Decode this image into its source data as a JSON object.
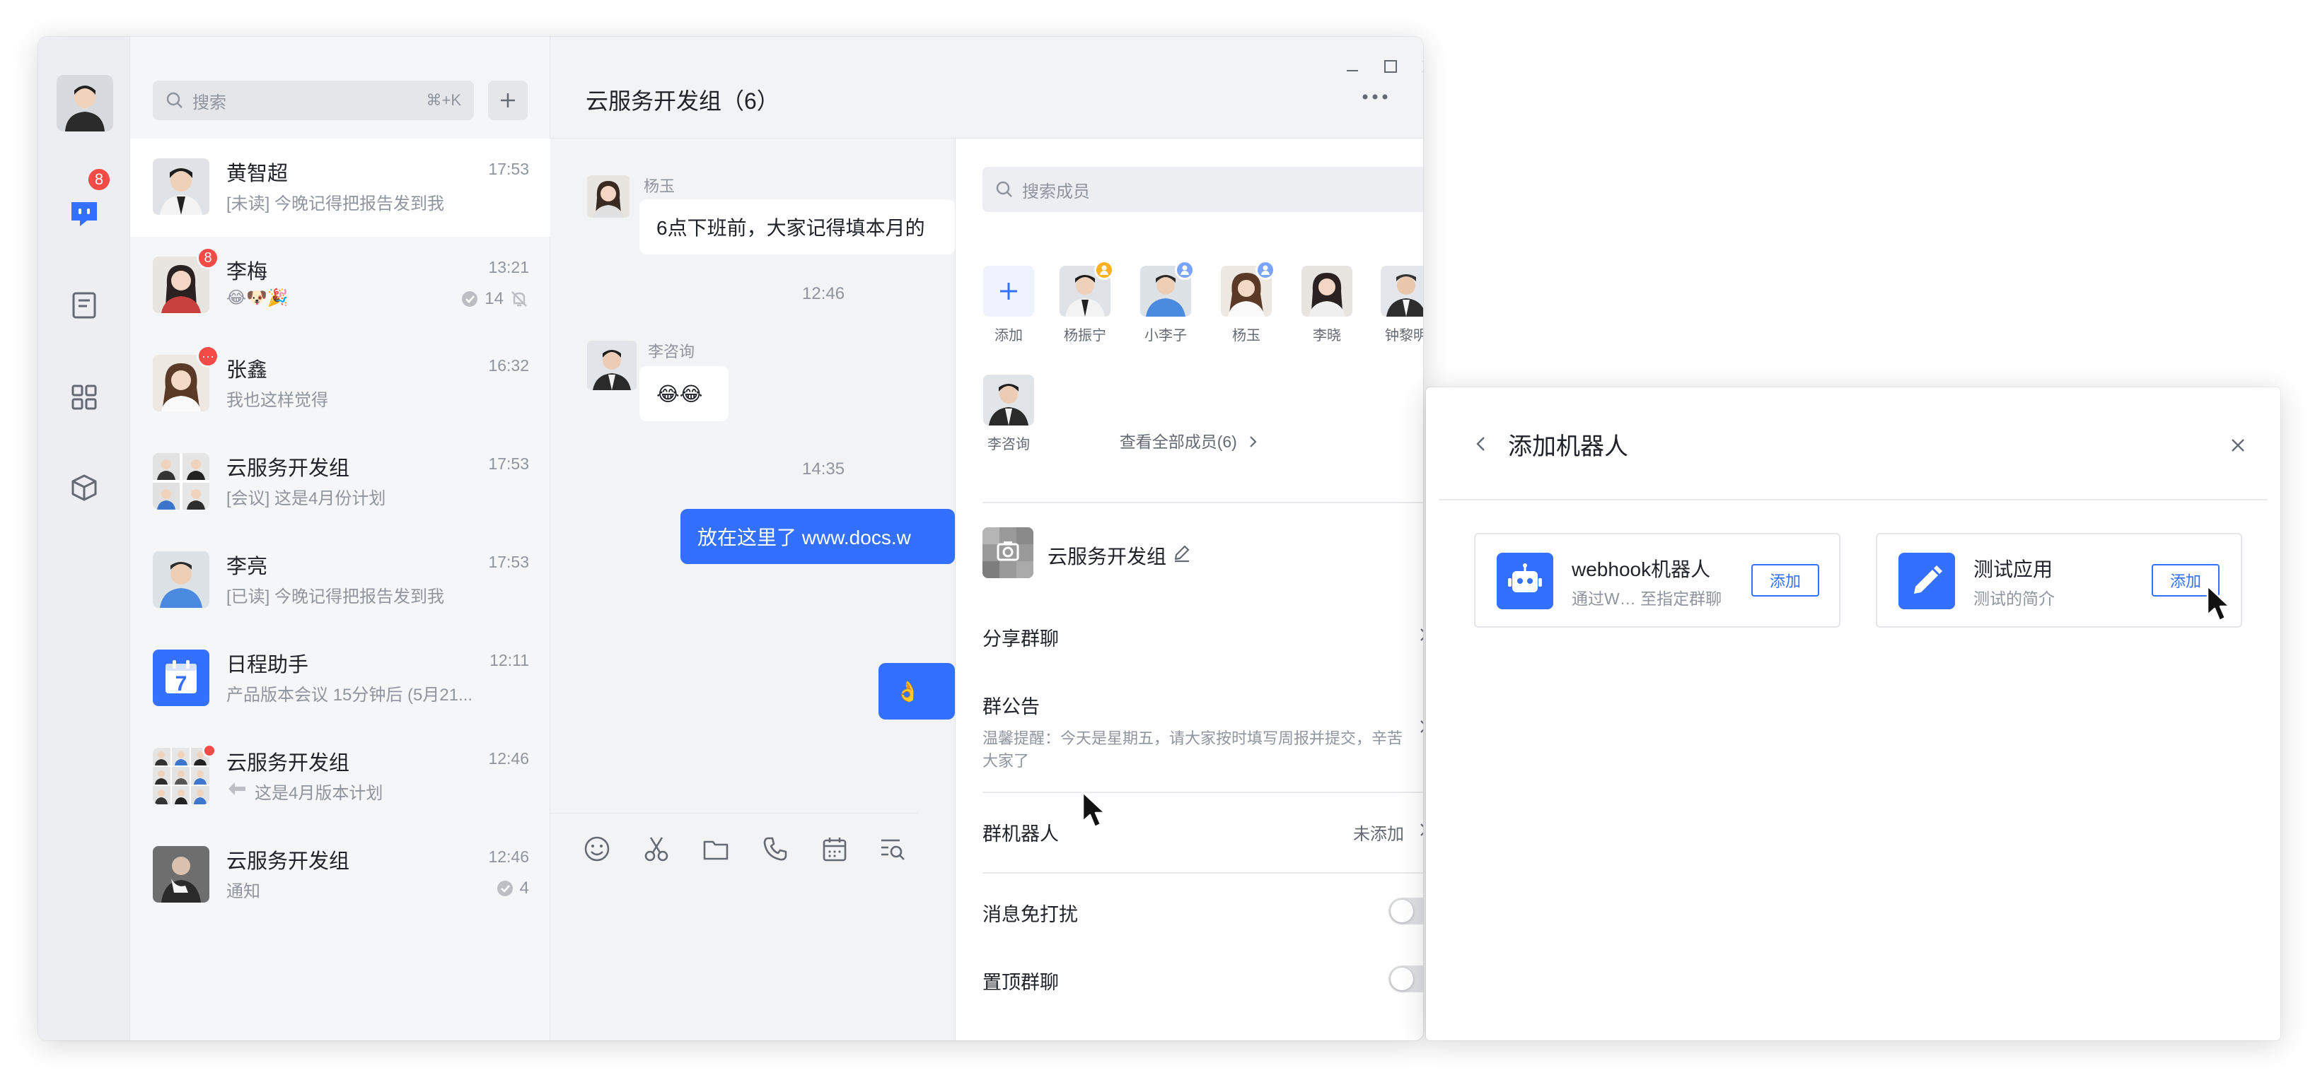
{
  "nav": {
    "messages_badge": "8",
    "icons": [
      "messages-icon",
      "docs-icon",
      "apps-icon",
      "cube-icon"
    ]
  },
  "search": {
    "placeholder": "搜索",
    "shortcut": "⌘+K"
  },
  "conversations": [
    {
      "name": "黄智超",
      "time": "17:53",
      "preview": "[未读] 今晚记得把报告发到我"
    },
    {
      "name": "李梅",
      "time": "13:21",
      "preview": "😂🐶🎉",
      "badge": "8",
      "read_count": "14"
    },
    {
      "name": "张鑫",
      "time": "16:32",
      "preview": "我也这样觉得",
      "badge": "···"
    },
    {
      "name": "云服务开发组",
      "time": "17:53",
      "preview": "[会议] 这是4月份计划"
    },
    {
      "name": "李亮",
      "time": "17:53",
      "preview": "[已读] 今晚记得把报告发到我"
    },
    {
      "name": "日程助手",
      "time": "12:11",
      "preview": "产品版本会议 15分钟后 (5月21...",
      "calendar_day": "7"
    },
    {
      "name": "云服务开发组",
      "time": "12:46",
      "preview": "这是4月版本计划"
    },
    {
      "name": "云服务开发组",
      "time": "12:46",
      "preview": "通知",
      "read_count": "4"
    }
  ],
  "chat": {
    "title": "云服务开发组（6）",
    "messages": [
      {
        "sender": "杨玉",
        "text": "6点下班前，大家记得填本月的"
      },
      {
        "timestamp": "12:46"
      },
      {
        "sender": "李咨询",
        "text": "😂😂"
      },
      {
        "timestamp": "14:35"
      },
      {
        "text": "放在这里了 www.docs.w"
      },
      {
        "text": "👌"
      }
    ]
  },
  "panel": {
    "member_search_placeholder": "搜索成员",
    "add_label": "添加",
    "members": [
      "杨振宁",
      "小李子",
      "杨玉",
      "李晓",
      "钟黎明",
      "李咨询"
    ],
    "view_all": "查看全部成员(6)",
    "group_name": "云服务开发组",
    "share_label": "分享群聊",
    "notice_label": "群公告",
    "notice_text": "温馨提醒：今天是星期五，请大家按时填写周报并提交，辛苦大家了",
    "robot_label": "群机器人",
    "robot_status": "未添加",
    "mute_label": "消息免打扰",
    "pin_label": "置顶群聊"
  },
  "dialog": {
    "title": "添加机器人",
    "cards": [
      {
        "name": "webhook机器人",
        "desc": "通过W… 至指定群聊",
        "button": "添加"
      },
      {
        "name": "测试应用",
        "desc": "测试的简介",
        "button": "添加"
      }
    ]
  },
  "colors": {
    "accent": "#3370ff",
    "badge": "#f54a45"
  }
}
